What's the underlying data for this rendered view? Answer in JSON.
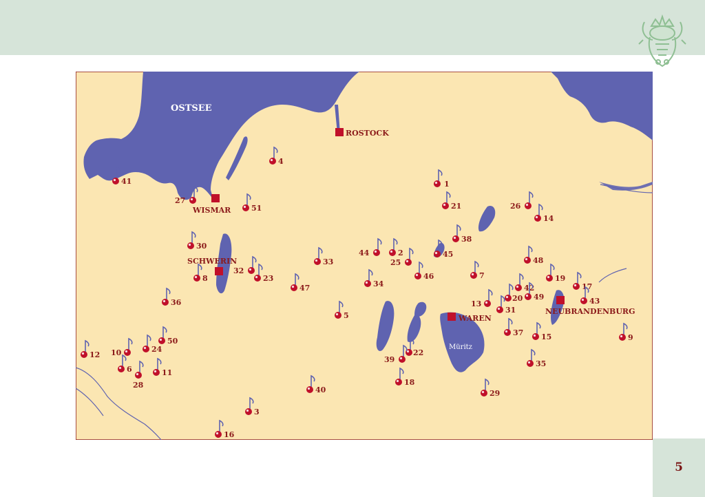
{
  "page": {
    "number": "5"
  },
  "colors": {
    "header_band": "#d6e4d9",
    "land": "#fbe6b2",
    "water": "#5f63b0",
    "marker": "#c0102a",
    "label": "#8b1a1a",
    "city": "#c0102a",
    "logo": "#8fbf93"
  },
  "map": {
    "sea_label": "OSTSEE",
    "lake_label": "Müritz",
    "cities": [
      {
        "id": "rostock",
        "name": "ROSTOCK"
      },
      {
        "id": "wismar",
        "name": "WISMAR"
      },
      {
        "id": "schwerin",
        "name": "SCHWERIN"
      },
      {
        "id": "waren",
        "name": "WAREN"
      },
      {
        "id": "neubrandenburg",
        "name": "NEUBRANDENBURG"
      }
    ],
    "markers": [
      "1",
      "2",
      "3",
      "4",
      "5",
      "6",
      "7",
      "8",
      "9",
      "10",
      "11",
      "12",
      "13",
      "14",
      "15",
      "16",
      "17",
      "18",
      "19",
      "20",
      "21",
      "22",
      "23",
      "24",
      "25",
      "26",
      "27",
      "28",
      "29",
      "30",
      "31",
      "32",
      "33",
      "34",
      "35",
      "36",
      "37",
      "38",
      "39",
      "40",
      "41",
      "42",
      "43",
      "44",
      "45",
      "46",
      "47",
      "48",
      "49",
      "50",
      "51"
    ]
  },
  "logo_icon": "bull-crest-icon",
  "marker_icon": "music-note-pin-icon"
}
